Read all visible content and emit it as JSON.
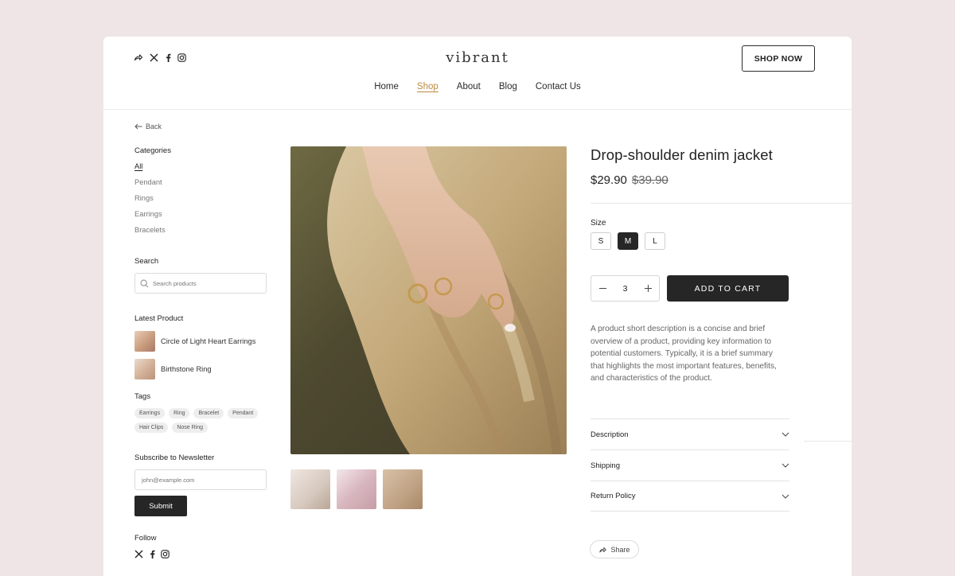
{
  "header": {
    "brand": "vibrant",
    "nav": [
      "Home",
      "Shop",
      "About",
      "Blog",
      "Contact Us"
    ],
    "active_nav": "Shop",
    "shop_now": "SHOP NOW"
  },
  "sidebar": {
    "back": "Back",
    "categories_title": "Categories",
    "categories": [
      "All",
      "Pendant",
      "Rings",
      "Earrings",
      "Bracelets"
    ],
    "search_title": "Search",
    "search_placeholder": "Search products",
    "latest_title": "Latest Product",
    "latest": [
      "Circle of Light Heart Earrings",
      "Birthstone Ring"
    ],
    "tags_title": "Tags",
    "tags": [
      "Earrings",
      "Ring",
      "Bracelet",
      "Pendant",
      "Hair Clips",
      "Nose Ring"
    ],
    "newsletter_title": "Subscribe to Newsletter",
    "newsletter_placeholder": "john@example.com",
    "submit": "Submit",
    "follow_title": "Follow"
  },
  "product": {
    "title": "Drop-shoulder denim jacket",
    "price": "$29.90",
    "old_price": "$39.90",
    "size_label": "Size",
    "sizes": [
      "S",
      "M",
      "L"
    ],
    "selected_size": "M",
    "quantity": "3",
    "add_to_cart": "ADD TO CART",
    "description": "A product short description is a concise and brief overview of a product, providing key information to potential customers. Typically, it is a brief summary that highlights the most important features, benefits, and characteristics of the product.",
    "accordion": [
      "Description",
      "Shipping",
      "Return Policy"
    ],
    "share": "Share"
  },
  "colors": {
    "background": "#efe5e6",
    "accent": "#b98a3d",
    "dark": "#262626"
  }
}
